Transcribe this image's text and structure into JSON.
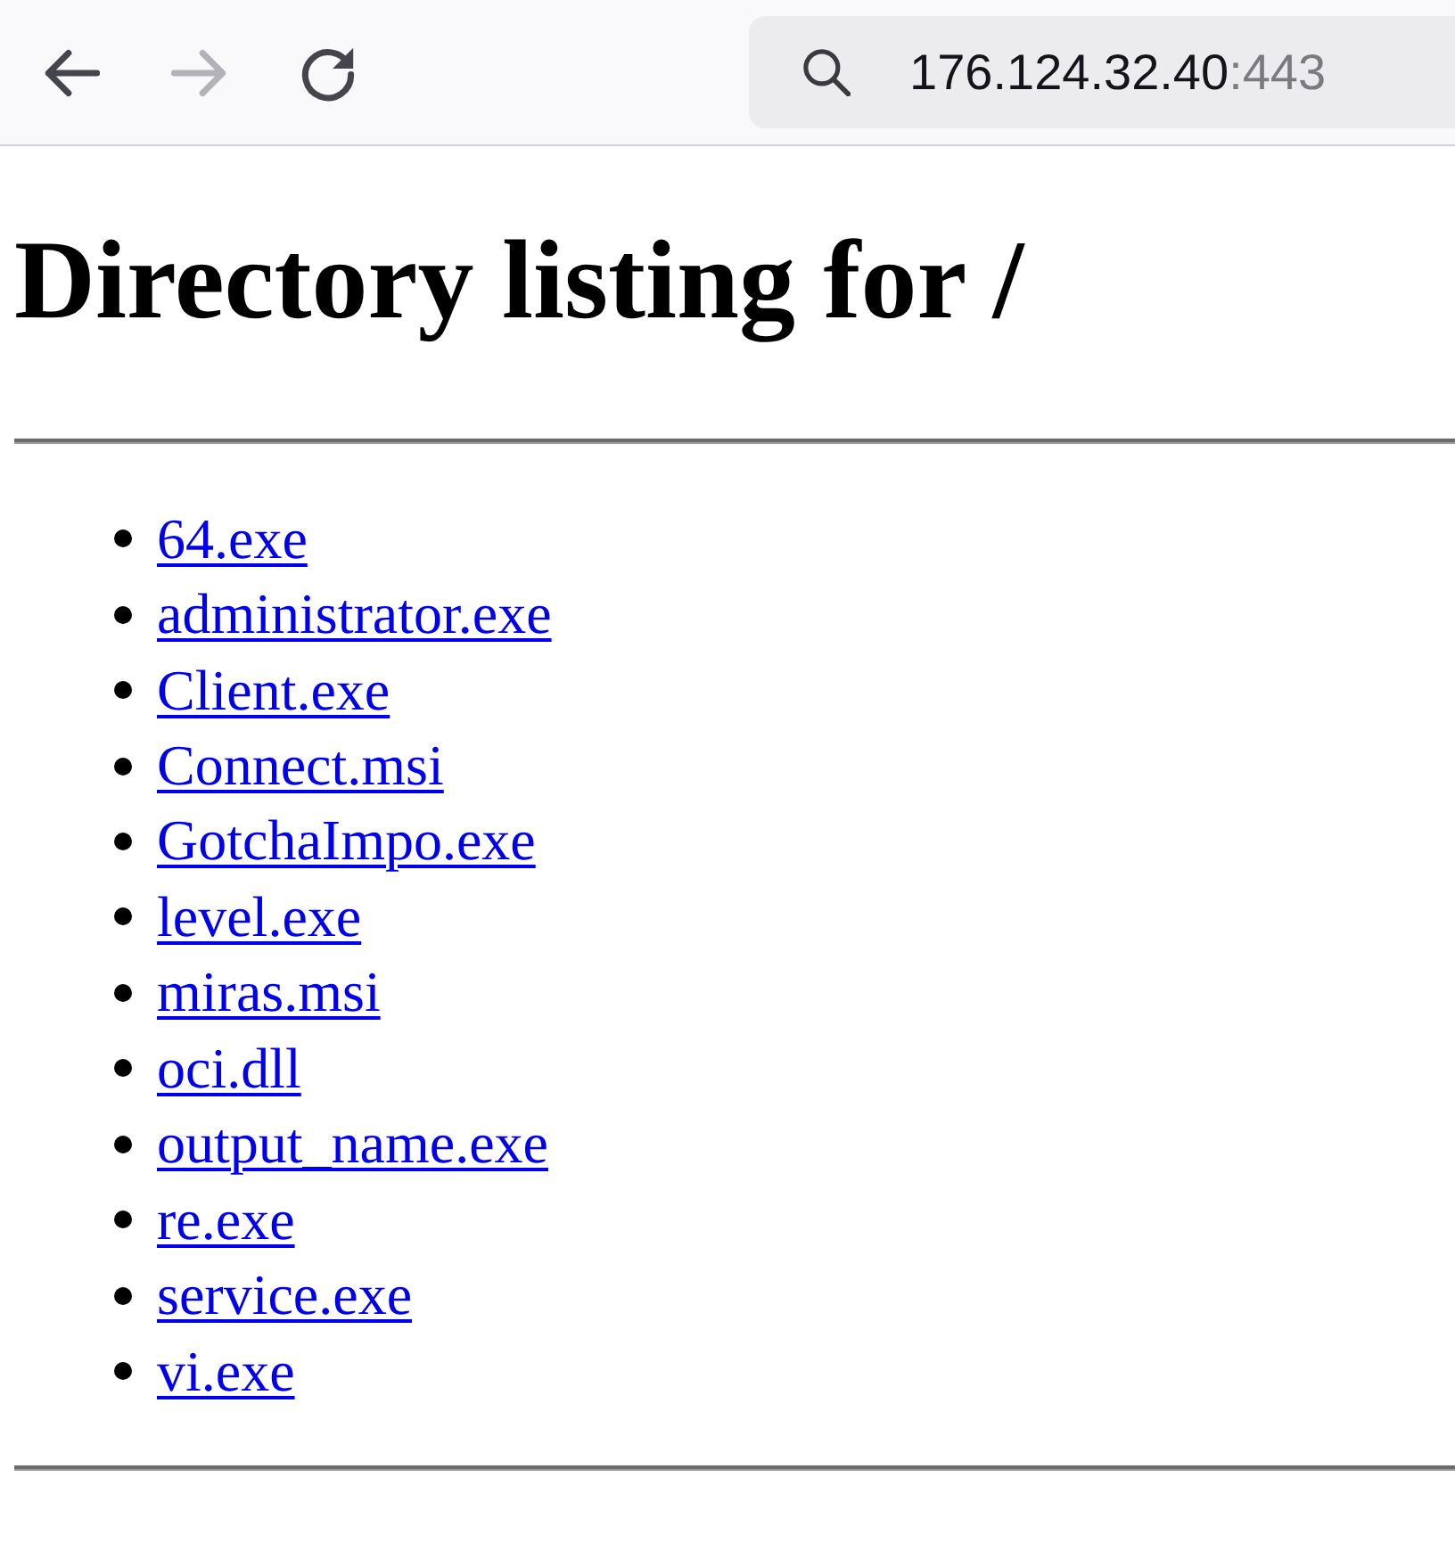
{
  "browser_toolbar": {
    "nav_buttons": [
      {
        "kind": "back",
        "disabled": false
      },
      {
        "kind": "forward",
        "disabled": true
      },
      {
        "kind": "reload",
        "disabled": false
      }
    ],
    "address_bar": {
      "host": "176.124.32.40",
      "port": ":443"
    }
  },
  "page": {
    "heading": "Directory listing for /",
    "files": [
      "64.exe",
      "administrator.exe",
      "Client.exe",
      "Connect.msi",
      "GotchaImpo.exe",
      "level.exe",
      "miras.msi",
      "oci.dll",
      "output_name.exe",
      "re.exe",
      "service.exe",
      "vi.exe"
    ]
  }
}
